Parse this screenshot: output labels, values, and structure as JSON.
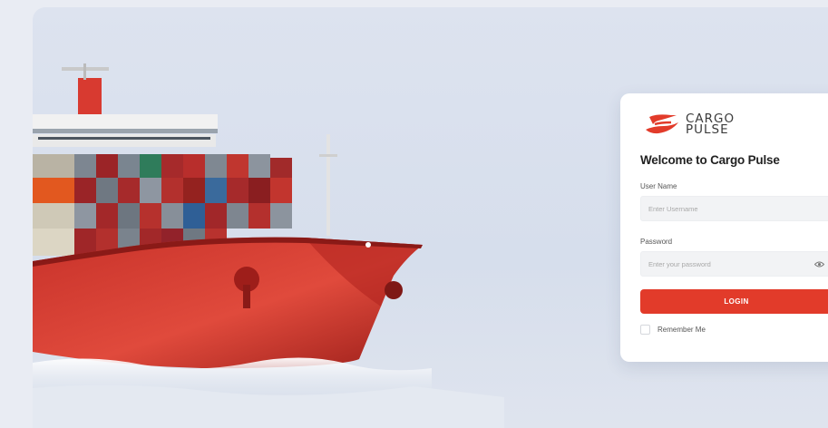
{
  "brand": {
    "name_line1": "CARGO",
    "name_line2": "PULSE",
    "logo_icon": "cargo-pulse-logo-icon",
    "accent_color": "#e23b2a"
  },
  "login": {
    "welcome": "Welcome to Cargo Pulse",
    "username_label": "User Name",
    "username_placeholder": "Enter Username",
    "username_value": "",
    "password_label": "Password",
    "password_placeholder": "Enter your password",
    "password_value": "",
    "password_toggle_icon": "eye-icon",
    "login_button": "LOGIN",
    "remember_label": "Remember Me",
    "remember_checked": false
  },
  "hero": {
    "image": "container-ship-illustration"
  }
}
